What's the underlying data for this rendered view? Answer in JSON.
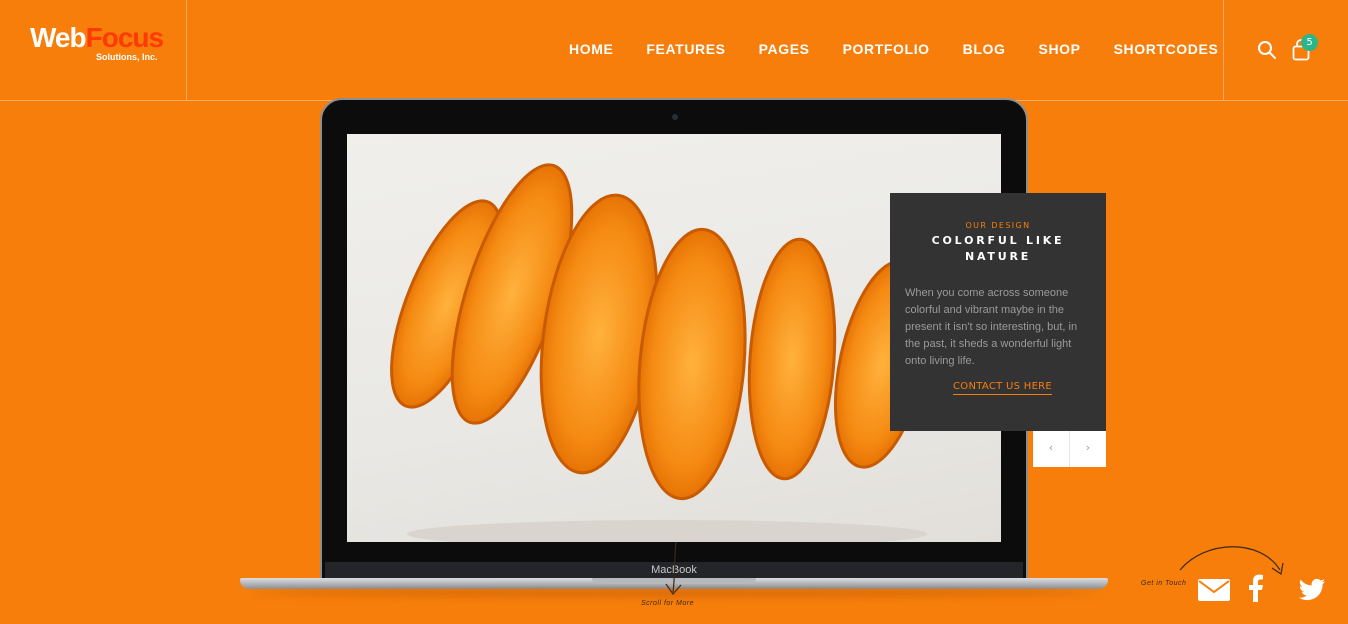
{
  "header": {
    "logo": {
      "word1": "Web",
      "word2": "Focus",
      "sub": "Solutions, Inc."
    },
    "nav": [
      "HOME",
      "FEATURES",
      "PAGES",
      "PORTFOLIO",
      "BLOG",
      "SHOP",
      "SHORTCODES"
    ],
    "cart_count": "5"
  },
  "laptop": {
    "brand": "MacBook"
  },
  "card": {
    "eyebrow": "OUR DESIGN",
    "title": "COLORFUL LIKE NATURE",
    "text": "When you come across someone colorful and vibrant maybe in the present it isn't so interesting, but, in the past, it sheds a wonderful light onto living life.",
    "link": "CONTACT US HERE"
  },
  "slider": {
    "prev": "‹",
    "next": "›"
  },
  "footer": {
    "scroll_label": "Scroll for More",
    "get_in_touch": "Get in Touch"
  },
  "colors": {
    "accent": "#f77e0b",
    "card_bg": "#333333",
    "badge": "#2bb58b"
  },
  "icons": [
    "search-icon",
    "cart-icon",
    "mail-icon",
    "facebook-icon",
    "twitter-icon"
  ]
}
